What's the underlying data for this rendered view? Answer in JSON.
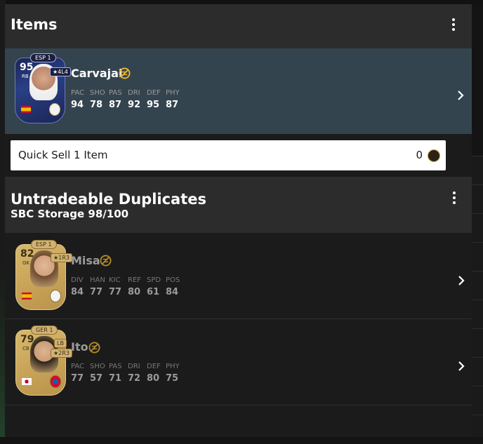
{
  "items_section": {
    "title": "Items",
    "item": {
      "name": "Carvajal",
      "rating": "95",
      "position": "RB",
      "league": "ESP 1",
      "skill_tag": "★4L4",
      "stat_labels": [
        "PAC",
        "SHO",
        "PAS",
        "DRI",
        "DEF",
        "PHY"
      ],
      "stat_values": [
        "94",
        "78",
        "87",
        "92",
        "95",
        "87"
      ],
      "card_style": "toty"
    }
  },
  "quick_sell": {
    "label": "Quick Sell 1 Item",
    "value": "0"
  },
  "duplicates_section": {
    "title": "Untradeable Duplicates",
    "subtitle": "SBC Storage 98/100",
    "items": [
      {
        "name": "Misa",
        "rating": "82",
        "position": "GK",
        "league": "ESP 1",
        "skill_tag": "★1R3",
        "stat_labels": [
          "DIV",
          "HAN",
          "KIC",
          "REF",
          "SPD",
          "POS"
        ],
        "stat_values": [
          "84",
          "77",
          "77",
          "80",
          "61",
          "84"
        ]
      },
      {
        "name": "Ito",
        "rating": "79",
        "position": "CB",
        "league": "GER 1",
        "alt_position": "LB",
        "skill_tag": "★2R3",
        "stat_labels": [
          "PAC",
          "SHO",
          "PAS",
          "DRI",
          "DEF",
          "PHY"
        ],
        "stat_values": [
          "77",
          "57",
          "71",
          "72",
          "80",
          "75"
        ]
      }
    ]
  },
  "colors": {
    "accent_gold": "#e7b631",
    "selected_row": "#34444f",
    "header_bg": "#2c2c2c"
  },
  "icons": [
    "kebab-menu-icon",
    "untradeable-icon",
    "chevron-right-icon",
    "coin-icon"
  ]
}
